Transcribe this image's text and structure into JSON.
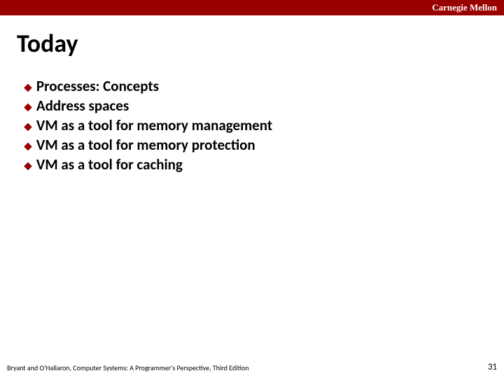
{
  "header": {
    "institution": "Carnegie Mellon"
  },
  "title": "Today",
  "bullets": [
    "Processes: Concepts",
    "Address spaces",
    "VM as a tool for memory management",
    "VM as a tool for memory protection",
    "VM as a tool for caching"
  ],
  "footer": {
    "left": "Bryant and O'Hallaron, Computer Systems: A Programmer's Perspective, Third Edition",
    "page_number": "31"
  }
}
